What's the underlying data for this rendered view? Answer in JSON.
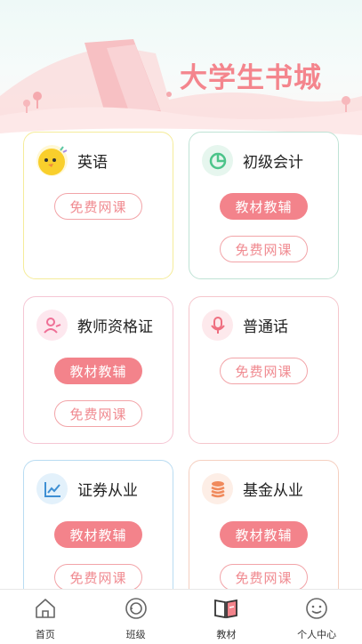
{
  "header": {
    "title": "大学生书城"
  },
  "colors": {
    "accent": "#f3838b",
    "accent_outline": "#f2a4a8"
  },
  "cards": [
    {
      "title": "英语",
      "icon": "chick-icon",
      "buttons": [
        "免费网课"
      ]
    },
    {
      "title": "初级会计",
      "icon": "pie-chart-icon",
      "buttons": [
        "教材教辅",
        "免费网课"
      ]
    },
    {
      "title": "教师资格证",
      "icon": "teacher-icon",
      "buttons": [
        "教材教辅",
        "免费网课"
      ]
    },
    {
      "title": "普通话",
      "icon": "microphone-icon",
      "buttons": [
        "免费网课"
      ]
    },
    {
      "title": "证券从业",
      "icon": "line-chart-icon",
      "buttons": [
        "教材教辅",
        "免费网课"
      ]
    },
    {
      "title": "基金从业",
      "icon": "coins-icon",
      "buttons": [
        "教材教辅",
        "免费网课"
      ]
    }
  ],
  "tabbar": [
    {
      "label": "首页",
      "icon": "home-icon"
    },
    {
      "label": "班级",
      "icon": "class-icon"
    },
    {
      "label": "教材",
      "icon": "book-icon"
    },
    {
      "label": "个人中心",
      "icon": "smile-icon"
    }
  ]
}
